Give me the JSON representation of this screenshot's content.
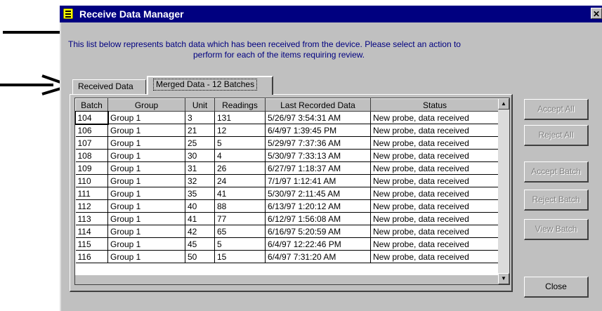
{
  "window": {
    "title": "Receive Data Manager",
    "close_glyph": "✕"
  },
  "description": {
    "line1": "This list below represents batch data which has been received from the device.  Please select an action to",
    "line2": "perform for each of the items requiring review."
  },
  "tabs": [
    {
      "label": "Received Data"
    },
    {
      "label": "Merged Data - 12 Batches"
    }
  ],
  "table": {
    "columns": [
      "Batch",
      "Group",
      "Unit",
      "Readings",
      "Last Recorded Data",
      "Status"
    ],
    "rows": [
      [
        "104",
        "Group 1",
        "3",
        "131",
        "5/26/97 3:54:31 AM",
        "New probe, data received"
      ],
      [
        "106",
        "Group 1",
        "21",
        "12",
        "6/4/97 1:39:45 PM",
        "New probe, data received"
      ],
      [
        "107",
        "Group 1",
        "25",
        "5",
        "5/29/97 7:37:36 AM",
        "New probe, data received"
      ],
      [
        "108",
        "Group 1",
        "30",
        "4",
        "5/30/97 7:33:13 AM",
        "New probe, data received"
      ],
      [
        "109",
        "Group 1",
        "31",
        "26",
        "6/27/97 1:18:37 AM",
        "New probe, data received"
      ],
      [
        "110",
        "Group 1",
        "32",
        "24",
        "7/1/97 1:12:41 AM",
        "New probe, data received"
      ],
      [
        "111",
        "Group 1",
        "35",
        "41",
        "5/30/97 2:11:45 AM",
        "New probe, data received"
      ],
      [
        "112",
        "Group 1",
        "40",
        "88",
        "6/13/97 1:20:12 AM",
        "New probe, data received"
      ],
      [
        "113",
        "Group 1",
        "41",
        "77",
        "6/12/97 1:56:08 AM",
        "New probe, data received"
      ],
      [
        "114",
        "Group 1",
        "42",
        "65",
        "6/16/97 5:20:59 AM",
        "New probe, data received"
      ],
      [
        "115",
        "Group 1",
        "45",
        "5",
        "6/4/97 12:22:46 PM",
        "New probe, data received"
      ],
      [
        "116",
        "Group 1",
        "50",
        "15",
        "6/4/97 7:31:20 AM",
        "New probe, data received"
      ]
    ]
  },
  "buttons": {
    "accept_all": "Accept All",
    "reject_all": "Reject All",
    "accept_batch": "Accept Batch",
    "reject_batch": "Reject Batch",
    "view_batch": "View Batch",
    "close": "Close"
  },
  "colors": {
    "title_bar": "#000080",
    "description_text": "#000080",
    "face": "#c0c0c0"
  },
  "icons": {
    "app": "app-icon",
    "scroll_up": "scroll-up-icon",
    "scroll_down": "scroll-down-icon"
  }
}
